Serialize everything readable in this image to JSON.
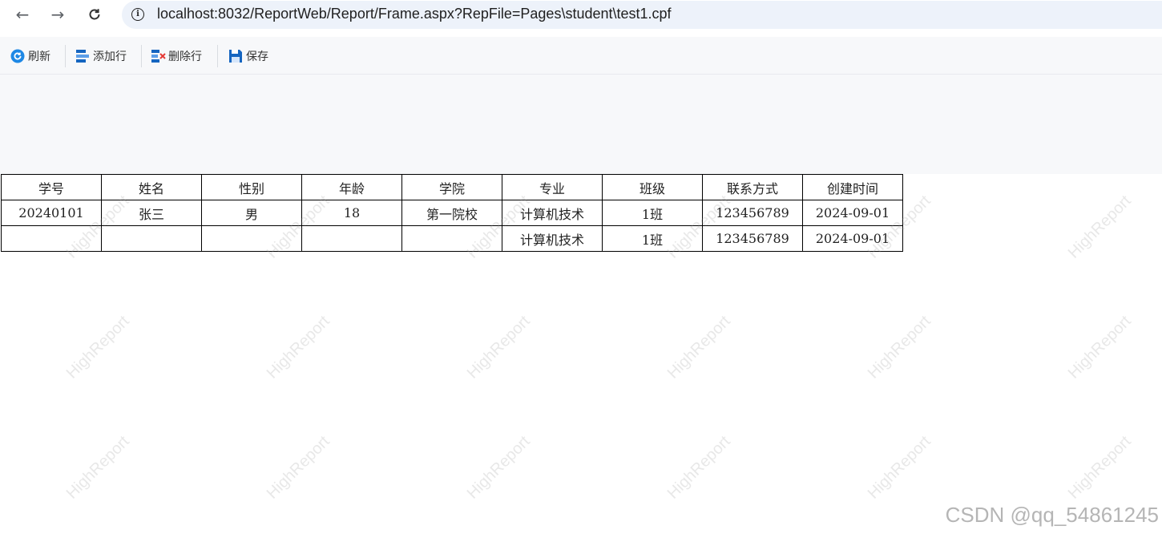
{
  "browser": {
    "url": "localhost:8032/ReportWeb/Report/Frame.aspx?RepFile=Pages\\student\\test1.cpf"
  },
  "toolbar": {
    "refresh_label": "刷新",
    "add_row_label": "添加行",
    "delete_row_label": "删除行",
    "save_label": "保存"
  },
  "table": {
    "headers": [
      "学号",
      "姓名",
      "性别",
      "年龄",
      "学院",
      "专业",
      "班级",
      "联系方式",
      "创建时间"
    ],
    "rows": [
      [
        "20240101",
        "张三",
        "男",
        "18",
        "第一院校",
        "计算机技术",
        "1班",
        "123456789",
        "2024-09-01"
      ],
      [
        "",
        "",
        "",
        "",
        "",
        "计算机技术",
        "1班",
        "123456789",
        "2024-09-01"
      ]
    ]
  },
  "watermark": {
    "text": "HighReport"
  },
  "footer_watermark": "CSDN @qq_54861245",
  "colors": {
    "toolbar_bg": "#f7f8fa",
    "address_bg": "#edf2fa",
    "refresh_icon": "#1e88e5",
    "save_icon": "#1565c0",
    "delete_mark": "#e53935"
  }
}
